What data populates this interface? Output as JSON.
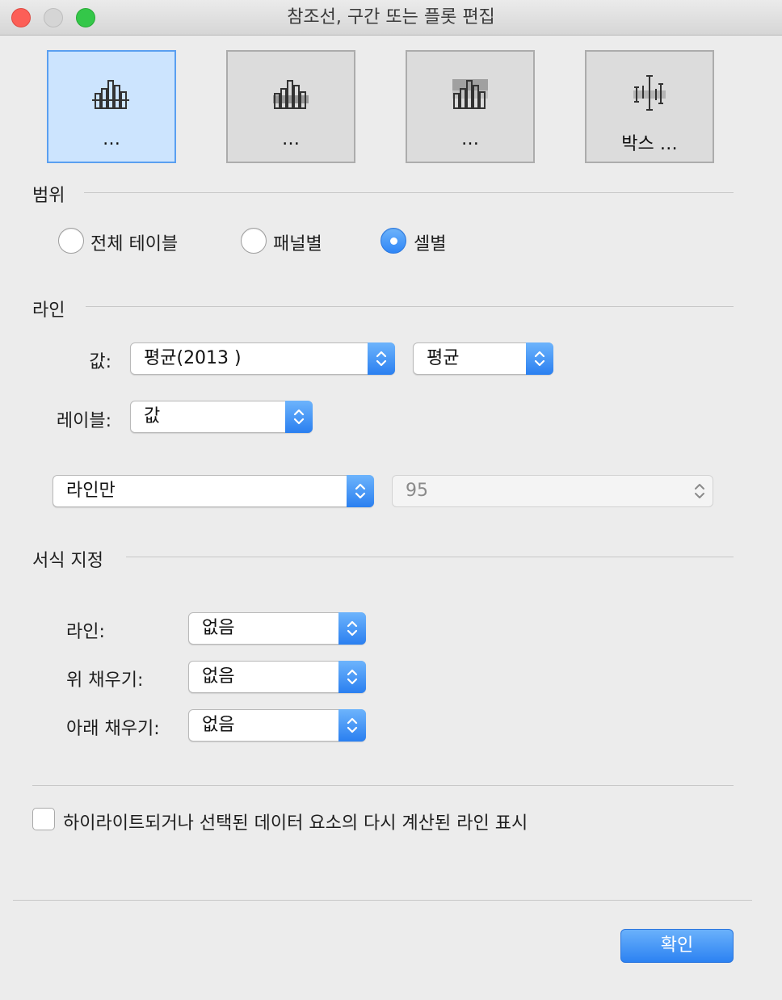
{
  "window": {
    "title": "참조선, 구간 또는 플롯 편집"
  },
  "type_buttons": [
    {
      "label": "…",
      "selected": true
    },
    {
      "label": "…",
      "selected": false
    },
    {
      "label": "…",
      "selected": false
    },
    {
      "label": "박스 …",
      "selected": false
    }
  ],
  "scope": {
    "header": "범위",
    "options": [
      {
        "label": "전체 테이블",
        "selected": false
      },
      {
        "label": "패널별",
        "selected": false
      },
      {
        "label": "셀별",
        "selected": true
      }
    ]
  },
  "line": {
    "header": "라인",
    "value_label": "값:",
    "value_field": "평균(2013 )",
    "aggregation": "평균",
    "label_label": "레이블:",
    "label_value": "값",
    "line_type": "라인만",
    "confidence": "95"
  },
  "formatting": {
    "header": "서식 지정",
    "line_label": "라인:",
    "line_value": "없음",
    "fill_above_label": "위 채우기:",
    "fill_above_value": "없음",
    "fill_below_label": "아래 채우기:",
    "fill_below_value": "없음"
  },
  "recalc_checkbox": {
    "label": "하이라이트되거나 선택된 데이터 요소의 다시 계산된 라인 표시",
    "checked": false
  },
  "ok_button": "확인",
  "colors": {
    "accent": "#2f86f6",
    "selected_tile": "#cce4fe"
  }
}
